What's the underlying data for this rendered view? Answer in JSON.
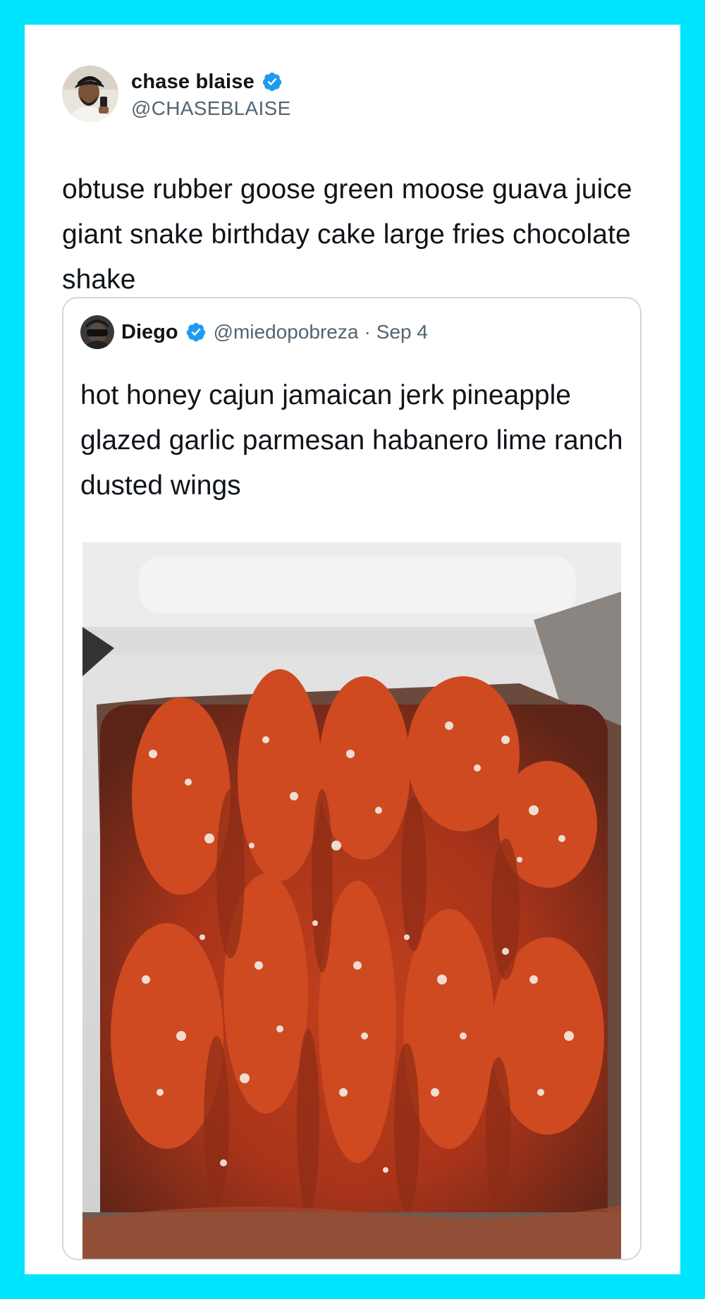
{
  "tweet": {
    "author": {
      "display_name": "chase blaise",
      "handle": "@CHASEBLAISE",
      "verified": true,
      "avatar_icon": "user-avatar"
    },
    "text": "obtuse rubber goose green moose guava juice giant snake birthday cake large fries chocolate shake"
  },
  "quoted_tweet": {
    "author": {
      "display_name": "Diego",
      "handle": "@miedopobreza",
      "verified": true,
      "avatar_icon": "user-avatar"
    },
    "separator": "·",
    "date": "Sep 4",
    "text": "hot honey cajun jamaican jerk pineapple glazed garlic parmesan habanero lime ranch dusted wings",
    "media": {
      "type": "photo",
      "icon": "food-photo"
    }
  },
  "colors": {
    "frame": "#00e5ff",
    "card": "#ffffff",
    "verified_badge": "#1d9bf0",
    "secondary_text": "#536471",
    "quote_border": "#cfd9de"
  }
}
